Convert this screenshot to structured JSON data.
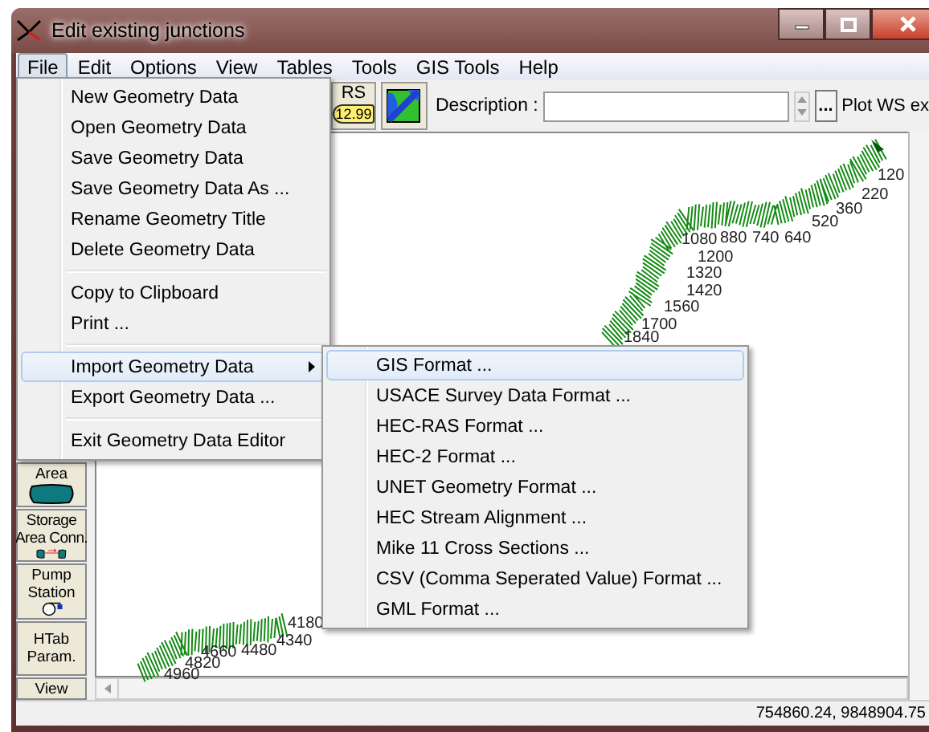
{
  "window": {
    "title": "Edit existing junctions"
  },
  "menu_bar": [
    {
      "label": "File",
      "selected": true
    },
    {
      "label": "Edit",
      "selected": false
    },
    {
      "label": "Options",
      "selected": false
    },
    {
      "label": "View",
      "selected": false
    },
    {
      "label": "Tables",
      "selected": false
    },
    {
      "label": "Tools",
      "selected": false
    },
    {
      "label": "GIS Tools",
      "selected": false
    },
    {
      "label": "Help",
      "selected": false
    }
  ],
  "file_menu": [
    {
      "kind": "item",
      "label": "New Geometry Data",
      "selected": false
    },
    {
      "kind": "item",
      "label": "Open Geometry Data",
      "selected": false
    },
    {
      "kind": "item",
      "label": "Save Geometry Data",
      "selected": false
    },
    {
      "kind": "item",
      "label": "Save Geometry Data As ...",
      "selected": false
    },
    {
      "kind": "item",
      "label": "Rename Geometry Title",
      "selected": false
    },
    {
      "kind": "item",
      "label": "Delete Geometry Data",
      "selected": false
    },
    {
      "kind": "separator"
    },
    {
      "kind": "item",
      "label": "Copy to Clipboard",
      "selected": false
    },
    {
      "kind": "item",
      "label": "Print ...",
      "selected": false
    },
    {
      "kind": "separator"
    },
    {
      "kind": "submenu",
      "label": "Import Geometry Data",
      "selected": true
    },
    {
      "kind": "item",
      "label": "Export Geometry Data ...",
      "selected": false
    },
    {
      "kind": "separator"
    },
    {
      "kind": "item",
      "label": "Exit Geometry Data Editor",
      "selected": false
    }
  ],
  "import_submenu": [
    {
      "label": "GIS Format ...",
      "selected": true
    },
    {
      "label": "USACE Survey Data Format ...",
      "selected": false
    },
    {
      "label": "HEC-RAS Format ...",
      "selected": false
    },
    {
      "label": "HEC-2 Format ...",
      "selected": false
    },
    {
      "label": "UNET Geometry Format ...",
      "selected": false
    },
    {
      "label": "HEC Stream Alignment ...",
      "selected": false
    },
    {
      "label": "Mike 11 Cross Sections ...",
      "selected": false
    },
    {
      "label": "CSV (Comma Seperated Value) Format ...",
      "selected": false
    },
    {
      "label": "GML Format ...",
      "selected": false
    }
  ],
  "toolbar": {
    "rs_button": {
      "label": "RS",
      "value": "12.99"
    },
    "description_label": "Description :",
    "browse_label": "...",
    "plot_label": "Plot WS ex"
  },
  "left_tools": [
    {
      "kind": "storage-area",
      "lines": [
        "Area"
      ]
    },
    {
      "kind": "storage-connection",
      "lines": [
        "Storage",
        "Area Conn."
      ]
    },
    {
      "kind": "pump",
      "lines": [
        "Pump",
        "Station"
      ]
    },
    {
      "kind": "text",
      "lines": [
        "HTab",
        "Param."
      ]
    },
    {
      "kind": "text",
      "lines": [
        "View"
      ]
    }
  ],
  "stations": [
    {
      "label": "120"
    },
    {
      "label": "220"
    },
    {
      "label": "360"
    },
    {
      "label": "520"
    },
    {
      "label": "1080"
    },
    {
      "label": "880"
    },
    {
      "label": "740"
    },
    {
      "label": "640"
    },
    {
      "label": "1200"
    },
    {
      "label": "1320"
    },
    {
      "label": "1420"
    },
    {
      "label": "1560"
    },
    {
      "label": "1700"
    },
    {
      "label": "1840"
    },
    {
      "label": "4180"
    },
    {
      "label": "4340"
    },
    {
      "label": "4660"
    },
    {
      "label": "4480"
    },
    {
      "label": "4820"
    },
    {
      "label": "4960"
    }
  ],
  "status_bar": {
    "coordinates": "754860.24, 9848904.75"
  }
}
